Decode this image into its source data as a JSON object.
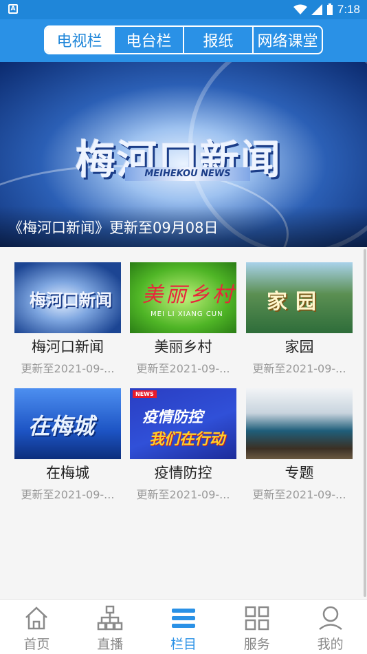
{
  "status_bar": {
    "time": "7:18",
    "app_icon": "A"
  },
  "tabs": [
    {
      "label": "电视栏",
      "active": true
    },
    {
      "label": "电台栏",
      "active": false
    },
    {
      "label": "报纸",
      "active": false
    },
    {
      "label": "网络课堂",
      "active": false
    }
  ],
  "banner": {
    "logo_text": "梅河口新闻",
    "logo_subtitle": "MEIHEKOU NEWS",
    "caption": "《梅河口新闻》更新至09月08日"
  },
  "programs": [
    {
      "title": "梅河口新闻",
      "subtitle": "更新至2021-09-...",
      "thumb_text": "梅河口新闻"
    },
    {
      "title": "美丽乡村",
      "subtitle": "更新至2021-09-...",
      "thumb_text": "美丽乡村",
      "thumb_sub": "MEI LI XIANG CUN"
    },
    {
      "title": "家园",
      "subtitle": "更新至2021-09-...",
      "thumb_text": "家园"
    },
    {
      "title": "在梅城",
      "subtitle": "更新至2021-09-...",
      "thumb_text": "在梅城"
    },
    {
      "title": "疫情防控",
      "subtitle": "更新至2021-09-...",
      "thumb_badge": "NEWS",
      "thumb_line1": "疫情防控",
      "thumb_line2": "我们在行动"
    },
    {
      "title": "专题",
      "subtitle": "更新至2021-09-..."
    }
  ],
  "bottom_nav": [
    {
      "label": "首页",
      "icon": "home-icon",
      "active": false
    },
    {
      "label": "直播",
      "icon": "network-icon",
      "active": false
    },
    {
      "label": "栏目",
      "icon": "menu-icon",
      "active": true
    },
    {
      "label": "服务",
      "icon": "grid-icon",
      "active": false
    },
    {
      "label": "我的",
      "icon": "user-icon",
      "active": false
    }
  ],
  "colors": {
    "primary": "#2a91e6",
    "status_bar": "#1f86d9",
    "inactive": "#8a8a8a"
  }
}
